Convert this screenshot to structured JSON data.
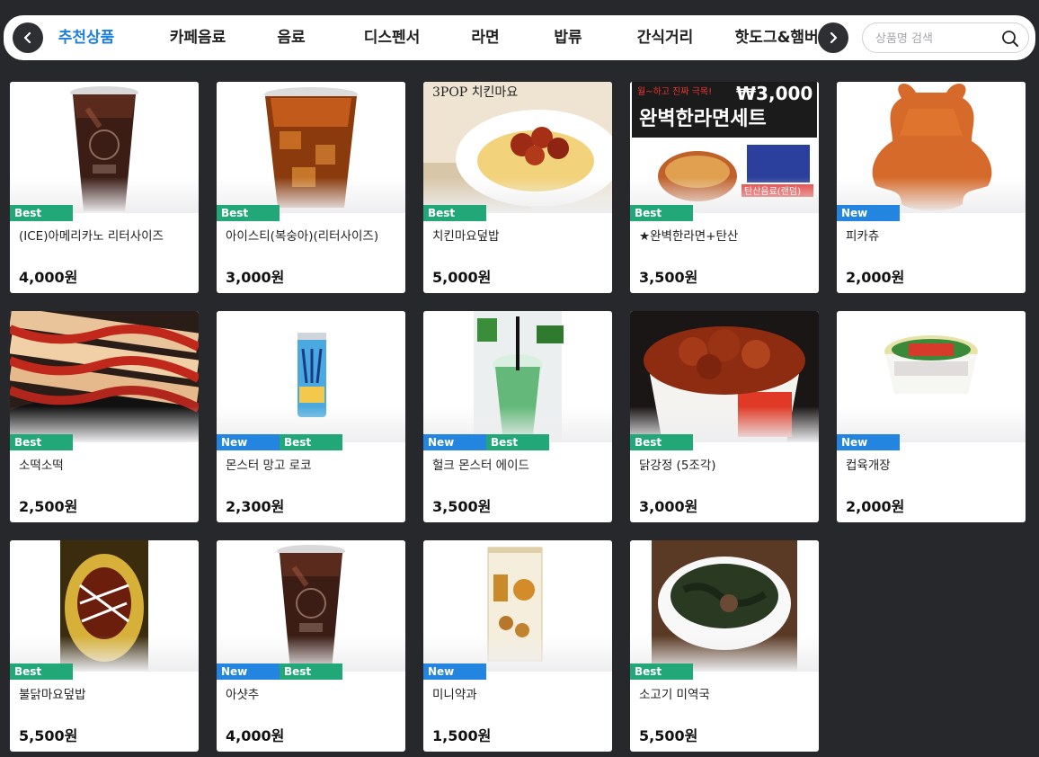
{
  "nav": {
    "tabs": [
      {
        "label": "추천상품",
        "active": true
      },
      {
        "label": "카페음료",
        "active": false
      },
      {
        "label": "음료",
        "active": false
      },
      {
        "label": "디스펜서",
        "active": false
      },
      {
        "label": "라면",
        "active": false
      },
      {
        "label": "밥류",
        "active": false
      },
      {
        "label": "간식거리",
        "active": false
      },
      {
        "label": "핫도그&햄버거",
        "active": false
      }
    ],
    "prev_icon": "chevron-left-icon",
    "next_icon": "chevron-right-icon"
  },
  "search": {
    "placeholder": "상품명 검색",
    "icon": "search-icon"
  },
  "colors": {
    "accent": "#1f7fe0",
    "best": "#22a878",
    "new": "#2385e0",
    "background": "#27282c"
  },
  "products": [
    {
      "name": "(ICE)아메리카노 리터사이즈",
      "price": "4,000원",
      "badges": [
        "Best"
      ],
      "image": "iced-americano"
    },
    {
      "name": "아이스티(복숭아)(리터사이즈)",
      "price": "3,000원",
      "badges": [
        "Best"
      ],
      "image": "iced-tea"
    },
    {
      "name": "치킨마요덮밥",
      "price": "5,000원",
      "badges": [
        "Best"
      ],
      "image": "chicken-mayo-rice",
      "image_text": "3POP 치킨마요"
    },
    {
      "name": "★완벽한라면+탄산",
      "price": "3,500원",
      "badges": [
        "Best"
      ],
      "image": "ramen-set",
      "image_text": [
        "월~하고 진짜 극목!",
        "₩3,000",
        "완벽한라면세트",
        "탄산음료(랜덤)"
      ]
    },
    {
      "name": "피카츄",
      "price": "2,000원",
      "badges": [
        "New"
      ],
      "image": "bear-cutlet"
    },
    {
      "name": "소떡소떡",
      "price": "2,500원",
      "badges": [
        "Best"
      ],
      "image": "sotteok"
    },
    {
      "name": "몬스터 망고 로코",
      "price": "2,300원",
      "badges": [
        "New",
        "Best"
      ],
      "image": "energy-can"
    },
    {
      "name": "헐크 몬스터 에이드",
      "price": "3,500원",
      "badges": [
        "New",
        "Best"
      ],
      "image": "green-ade"
    },
    {
      "name": "닭강정 (5조각)",
      "price": "3,000원",
      "badges": [
        "Best"
      ],
      "image": "chicken-bucket"
    },
    {
      "name": "컵육개장",
      "price": "2,000원",
      "badges": [
        "New"
      ],
      "image": "cup-noodle"
    },
    {
      "name": "불닭마요덮밥",
      "price": "5,500원",
      "badges": [
        "Best"
      ],
      "image": "buldak-rice"
    },
    {
      "name": "아샷추",
      "price": "4,000원",
      "badges": [
        "New",
        "Best"
      ],
      "image": "iced-tea-shot"
    },
    {
      "name": "미니약과",
      "price": "1,500원",
      "badges": [
        "New"
      ],
      "image": "mini-yakgwa"
    },
    {
      "name": "소고기 미역국",
      "price": "5,500원",
      "badges": [
        "Best"
      ],
      "image": "seaweed-soup"
    }
  ]
}
